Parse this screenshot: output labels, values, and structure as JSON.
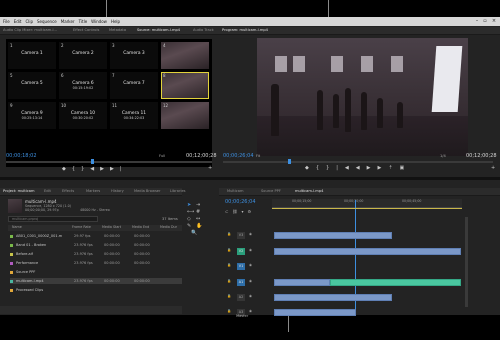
{
  "menubar": {
    "items": [
      "File",
      "Edit",
      "Clip",
      "Sequence",
      "Marker",
      "Title",
      "Window",
      "Help"
    ]
  },
  "source_monitor": {
    "tabs": [
      "Audio Clip Mixer: multicam-l...",
      "Effect Controls",
      "Metadata",
      "Source: multicam-l.mp4",
      "Audio Track"
    ],
    "cameras": [
      {
        "num": "1",
        "label": "Camera 1",
        "tc": ""
      },
      {
        "num": "2",
        "label": "Camera 2",
        "tc": ""
      },
      {
        "num": "3",
        "label": "Camera 3",
        "tc": ""
      },
      {
        "num": "4",
        "label": "",
        "tc": ""
      },
      {
        "num": "5",
        "label": "Camera 5",
        "tc": ""
      },
      {
        "num": "6",
        "label": "Camera 6",
        "tc": "00:15:19:02"
      },
      {
        "num": "7",
        "label": "Camera 7",
        "tc": ""
      },
      {
        "num": "8",
        "label": "",
        "tc": ""
      },
      {
        "num": "9",
        "label": "Camera 9",
        "tc": "00:25:13:14"
      },
      {
        "num": "10",
        "label": "Camera 10",
        "tc": "00:30:20:02"
      },
      {
        "num": "11",
        "label": "Camera 11",
        "tc": "00:34:22:03"
      },
      {
        "num": "12",
        "label": "",
        "tc": ""
      }
    ],
    "tc_left": "00;00;18;02",
    "fit": "Full",
    "tc_right": "00;12;00;28"
  },
  "program_monitor": {
    "tab": "Program: multicam-l.mp4",
    "tc_left": "00;00;26;04",
    "fit": "Fit",
    "scale": "1/4",
    "tc_right": "00;12;00;28"
  },
  "project_panel": {
    "tabs": [
      "Project: multicam",
      "Edit",
      "Effects",
      "Markers",
      "History",
      "Media Browser",
      "Libraries"
    ],
    "clip_name": "multicam-l.mp4",
    "clip_info": "Sequence, 1280 x 720 (1.0)",
    "clip_info2": "00;00;00;00, 29.97p",
    "clip_info3": "48000 Hz - Stereo",
    "search_placeholder": "multicam.prproj",
    "items_count": "37 Items",
    "columns": [
      "Name",
      "Frame Rate",
      "Media Start",
      "Media End",
      "Media Dur"
    ],
    "rows": [
      {
        "name": "AB01_C001_0000Z_001.m",
        "fps": "29.97 fps",
        "start": "00:00:00",
        "end": "00:00:00",
        "color": "#7ab94a"
      },
      {
        "name": "Band 01 - Broken",
        "fps": "23.976 fps",
        "start": "00:00:00",
        "end": "00:00:00",
        "color": "#7ab94a"
      },
      {
        "name": "Before.aif",
        "fps": "23.976 fps",
        "start": "00:00:00",
        "end": "00:00:00",
        "color": "#c7c44b"
      },
      {
        "name": "Performance",
        "fps": "23.976 fps",
        "start": "00:00:00",
        "end": "00:00:00",
        "color": "#b05cc0"
      },
      {
        "name": "Source PPF",
        "fps": "",
        "start": "",
        "end": "",
        "color": "#e1a83b"
      },
      {
        "name": "multicam-l.mp4",
        "fps": "23.976 fps",
        "start": "00:00:00",
        "end": "00:00:00",
        "color": "#4ab6a0"
      },
      {
        "name": "Processed Clips",
        "fps": "",
        "start": "",
        "end": "",
        "color": "#e1a83b"
      }
    ]
  },
  "timeline": {
    "tabs": [
      "Multicam",
      "Source PPF",
      "multicam-l.mp4"
    ],
    "timecode": "00;00;26;04",
    "ruler": [
      "00;00;15;00",
      "00;00;30;00",
      "00;00;45;00"
    ],
    "tracks": [
      "V3",
      "V2",
      "V1",
      "A1",
      "A2",
      "A3"
    ],
    "master": "Master"
  },
  "colors": {
    "accent": "#3d8fe0",
    "selection": "#e2d33b",
    "clip_video": "#7b98c8",
    "clip_green": "#4ac7a0"
  }
}
